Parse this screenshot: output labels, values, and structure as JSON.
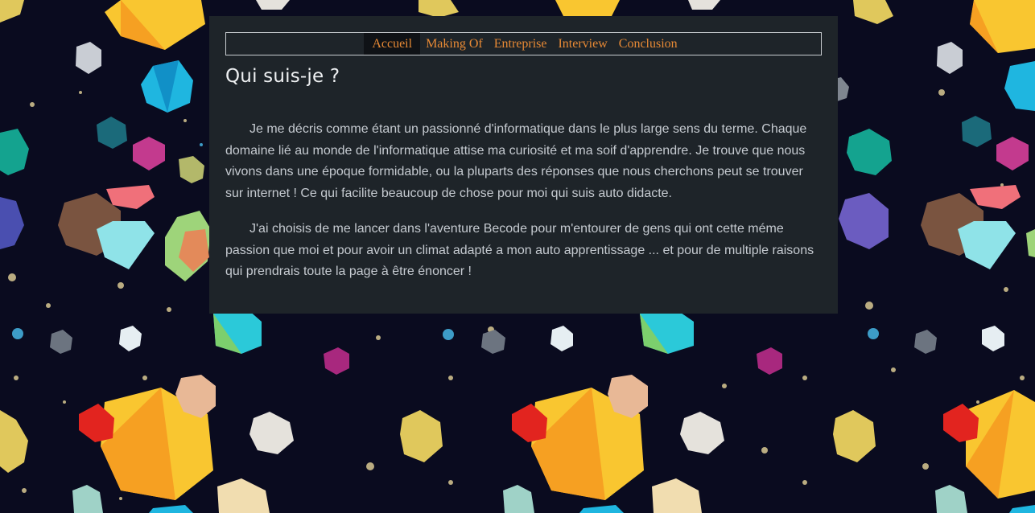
{
  "nav": {
    "items": [
      {
        "label": "Accueil",
        "active": true
      },
      {
        "label": "Making Of",
        "active": false
      },
      {
        "label": "Entreprise",
        "active": false
      },
      {
        "label": "Interview",
        "active": false
      },
      {
        "label": "Conclusion",
        "active": false
      }
    ]
  },
  "page": {
    "title": "Qui suis-je ?",
    "paragraphs": [
      "Je me décris comme étant un passionné d'informatique dans le plus large sens du terme. Chaque domaine lié au monde de l'informatique attise ma curiosité et ma soif d'apprendre. Je trouve que nous vivons dans une époque formidable, ou la pluparts des réponses que nous cherchons peut se trouver sur internet ! Ce qui facilite beaucoup de chose pour moi qui suis auto didacte.",
      "J'ai choisis de me lancer dans l'aventure Becode pour m'entourer de gens qui ont cette méme passion que moi et pour avoir un climat adapté a mon auto apprentissage ... et pour de multiple raisons qui prendrais toute la page à être énoncer !"
    ]
  },
  "colors": {
    "background": "#0a0b1f",
    "panel": "#1e2429",
    "nav_link": "#e88a35",
    "nav_active_bg": "#0f1216",
    "title": "#eef0f2",
    "body_text": "#c5cad0"
  },
  "background_pattern": {
    "description_icons": [
      "gem-icon",
      "star-dot-icon"
    ]
  }
}
